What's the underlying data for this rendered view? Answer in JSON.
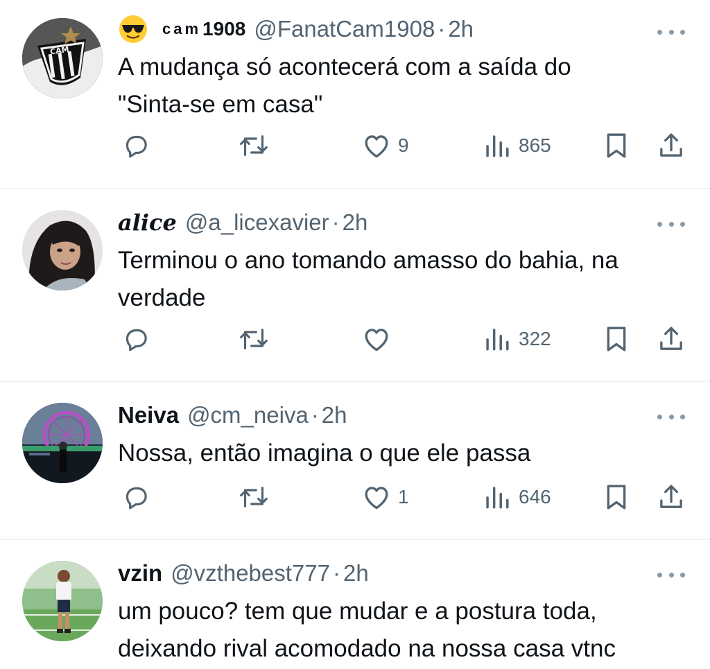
{
  "tweets": [
    {
      "display_name": "cam",
      "display_name_num": "1908",
      "handle": "@FanatCam1908",
      "time": "2h",
      "text_lines": [
        "A mudança só acontecerá com a saída do",
        "\"Sinta-se em casa\""
      ],
      "likes": "9",
      "views": "865",
      "avatar": "atletico-mineiro-crest-avatar",
      "emoji": "sunglasses-emoji"
    },
    {
      "display_name": "alice",
      "handle": "@a_licexavier",
      "time": "2h",
      "text_lines": [
        "Terminou o ano tomando amasso do bahia, na",
        "verdade"
      ],
      "likes": "",
      "views": "322",
      "avatar": "woman-photo-avatar"
    },
    {
      "display_name": "Neiva",
      "handle": "@cm_neiva",
      "time": "2h",
      "text_lines": [
        "Nossa, então imagina o que ele passa"
      ],
      "likes": "1",
      "views": "646",
      "avatar": "london-eye-photo-avatar"
    },
    {
      "display_name": "vzin",
      "handle": "@vzthebest777",
      "time": "2h",
      "text_lines": [
        "um pouco? tem que mudar e a postura toda,",
        "deixando rival acomodado na nossa casa vtnc"
      ],
      "avatar": "football-field-photo-avatar"
    }
  ],
  "separator": "·",
  "colors": {
    "text": "#0f1419",
    "secondary": "#536471",
    "divider": "#eff3f4",
    "more": "#8b98a5"
  }
}
